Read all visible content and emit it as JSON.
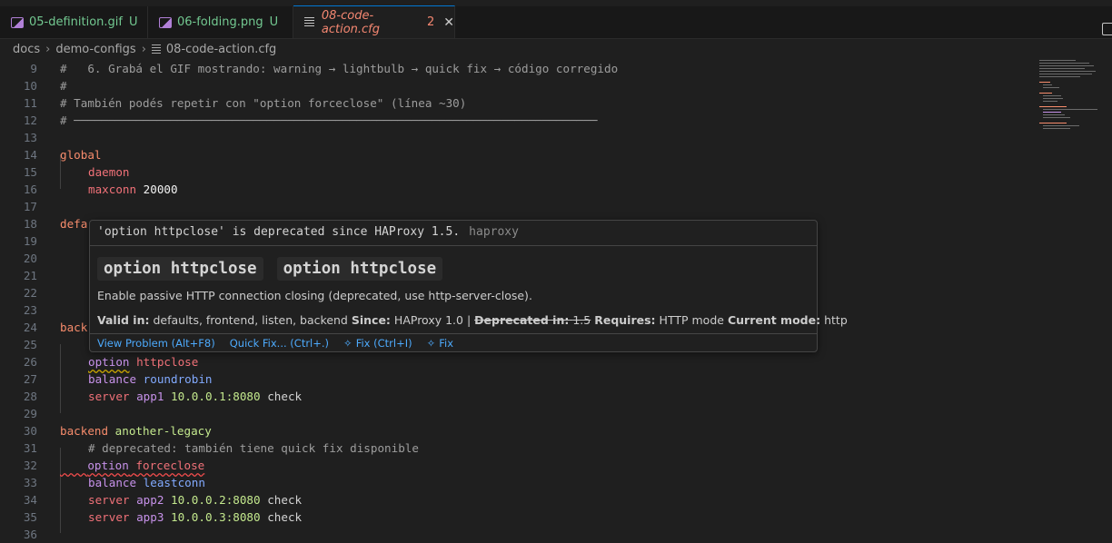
{
  "tabs": [
    {
      "name": "05-definition.gif",
      "status": "U",
      "icon": "image-file-icon"
    },
    {
      "name": "06-folding.png",
      "status": "U",
      "icon": "image-file-icon"
    },
    {
      "name": "08-code-action.cfg",
      "count": "2",
      "close": "✕",
      "icon": "text-file-icon"
    }
  ],
  "breadcrumb": {
    "parts": [
      "docs",
      "demo-configs",
      "08-code-action.cfg"
    ],
    "sep": "›"
  },
  "lines": {
    "l9": {
      "n": "9",
      "t": "#   6. Grabá el GIF mostrando: warning → lightbulb → quick fix → código corregido"
    },
    "l10": {
      "n": "10",
      "t": "#"
    },
    "l11": {
      "n": "11",
      "t": "# También podés repetir con \"option forceclose\" (línea ~30)"
    },
    "l12": {
      "n": "12",
      "t": "# ────────────────────────────────────────────────────────────────────────────"
    },
    "l13": {
      "n": "13"
    },
    "l14": {
      "n": "14",
      "kw": "global"
    },
    "l15": {
      "n": "15",
      "kw": "daemon"
    },
    "l16": {
      "n": "16",
      "kw": "maxconn",
      "v": "20000"
    },
    "l17": {
      "n": "17"
    },
    "l18": {
      "n": "18",
      "kw": "defa"
    },
    "l19": {
      "n": "19"
    },
    "l20": {
      "n": "20"
    },
    "l21": {
      "n": "21"
    },
    "l22": {
      "n": "22"
    },
    "l23": {
      "n": "23"
    },
    "l24": {
      "n": "24",
      "kw": "back"
    },
    "l25": {
      "n": "25"
    },
    "l26": {
      "n": "26",
      "kw": "option",
      "v": "httpclose"
    },
    "l27": {
      "n": "27",
      "kw": "balance",
      "v": "roundrobin"
    },
    "l28": {
      "n": "28",
      "kw": "server",
      "name": "app1",
      "v": "10.0.0.1:8080",
      "v2": "check"
    },
    "l29": {
      "n": "29"
    },
    "l30": {
      "n": "30",
      "kw": "backend",
      "name": "another-legacy"
    },
    "l31": {
      "n": "31",
      "t": "# deprecated: también tiene quick fix disponible"
    },
    "l32": {
      "n": "32",
      "kw": "option",
      "v": "forceclose"
    },
    "l33": {
      "n": "33",
      "kw": "balance",
      "v": "leastconn"
    },
    "l34": {
      "n": "34",
      "kw": "server",
      "name": "app2",
      "v": "10.0.0.2:8080",
      "v2": "check"
    },
    "l35": {
      "n": "35",
      "kw": "server",
      "name": "app3",
      "v": "10.0.0.3:8080",
      "v2": "check"
    },
    "l36": {
      "n": "36"
    }
  },
  "hover": {
    "message": "'option httpclose' is deprecated since HAProxy 1.5.",
    "source": "haproxy",
    "code1": "option httpclose",
    "code2": "option httpclose",
    "description": "Enable passive HTTP connection closing (deprecated, use http-server-close).",
    "meta": {
      "valid_label": "Valid in:",
      "valid": "defaults, frontend, listen, backend",
      "since_label": "Since:",
      "since": "HAProxy 1.0 |",
      "deprecated_label": "Deprecated in:",
      "deprecated": "1.5",
      "requires_label": "Requires:",
      "requires": "HTTP mode",
      "current_label": "Current mode:",
      "current": "http"
    },
    "actions": {
      "view_problem": "View Problem (Alt+F8)",
      "quick_fix": "Quick Fix... (Ctrl+.)",
      "fix": "Fix (Ctrl+I)",
      "fix2": "Fix"
    }
  },
  "colors": {
    "accent": "#0078d4",
    "error": "#f14c4c",
    "untracked": "#73c991",
    "link": "#4daafc"
  }
}
